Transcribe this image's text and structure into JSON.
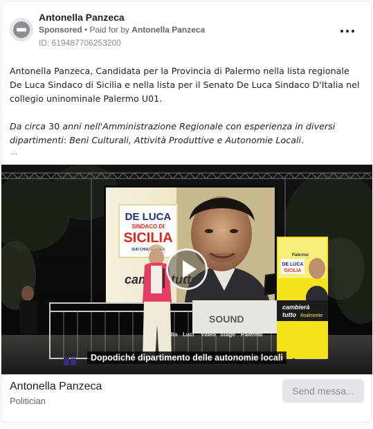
{
  "ad": {
    "page_name": "Antonella Panzeca",
    "sponsored_label": "Sponsored",
    "paid_prefix": " • Paid for by ",
    "paid_by": "Antonella Panzeca",
    "library_id": "ID: 619487706253200",
    "more_icon": "more-horizontal-icon",
    "avatar_icon": "no-entry-icon"
  },
  "body": {
    "paragraph1": "Antonella Panzeca, Candidata per la Provincia di Palermo nella lista regionale De Luca Sindaco di Sicilia e nella lista per il Senato De Luca Sindaco D'Italia nel collegio uninominale Palermo U01.",
    "p2_a": "Da circa ",
    "p2_b": "30",
    "p2_c": " anni nell'Amministrazione Regionale con esperienza in diversi dipartimenti",
    "p2_d": ": ",
    "p2_e": "Beni Culturali, Attività Produttive e Autonomie Locali",
    "p2_f": ".",
    "ellipsis": "..."
  },
  "video": {
    "subtitle": "Dopodiché dipartimento delle autonomie locali",
    "screen_logo": {
      "line1": "DE LUCA",
      "line2": "SINDACO DI",
      "line3": "SICILIA",
      "line4": "SUD CHIAMA NORD",
      "slogan": "cambia tutto"
    },
    "banner": {
      "top": "Palermo",
      "logo1": "DE LUCA",
      "logo2": "SICILIA",
      "slogan1": "cambierà",
      "slogan2": "tutto",
      "slogan3": "finalmente"
    },
    "stage_sign": "SOUND",
    "table_words": [
      "Audio",
      "Luci",
      "Video",
      "Stage",
      "Palermo"
    ]
  },
  "footer": {
    "name": "Antonella Panzeca",
    "category": "Politician",
    "cta_label": "Send messa..."
  }
}
